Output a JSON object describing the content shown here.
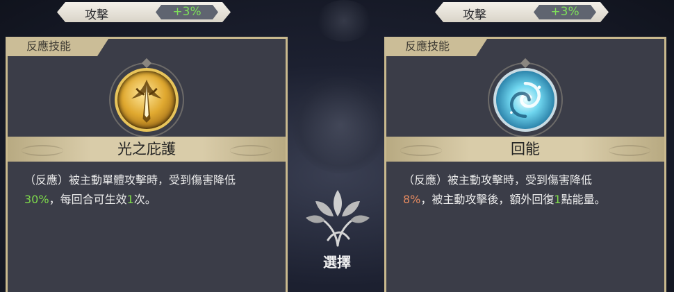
{
  "left": {
    "stat": {
      "name": "攻擊",
      "value": "+3%"
    },
    "tag": "反應技能",
    "emblem_icon": "golden-shield-leaf-icon",
    "skill_name": "光之庇護",
    "desc": {
      "p1": "（反應）被主動單體攻擊時，受到傷害降低",
      "hl1": "30%",
      "p2": "，每回合可生效",
      "hl2": "1",
      "p3": "次。"
    }
  },
  "right": {
    "stat": {
      "name": "攻擊",
      "value": "+3%"
    },
    "tag": "反應技能",
    "emblem_icon": "blue-swirl-icon",
    "skill_name": "回能",
    "desc": {
      "p1": "（反應）被主動攻擊時，受到傷害降低",
      "hl1": "8%",
      "p2": "，被主動攻擊後，額外回復",
      "hl2": "1",
      "p3": "點能量。"
    }
  },
  "center": {
    "select_label": "選擇",
    "select_icon": "leaf-branch-icon"
  },
  "colors": {
    "highlight_green": "#7edb4b",
    "highlight_orange": "#e58a60",
    "stat_value": "#7ee05a"
  }
}
